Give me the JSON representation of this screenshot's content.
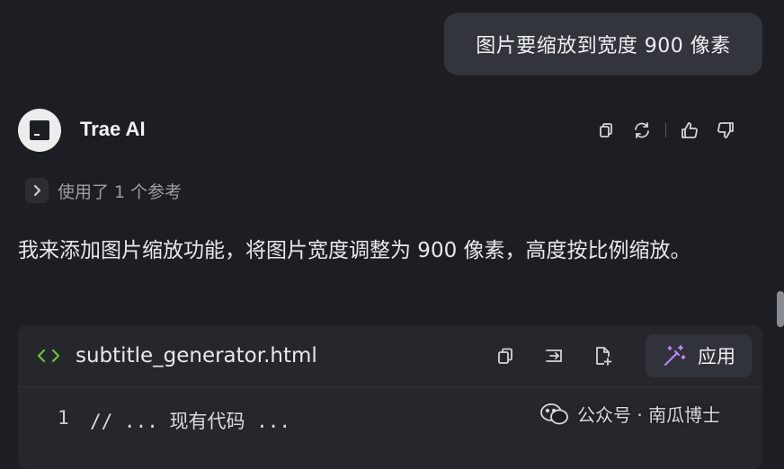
{
  "user_message": {
    "text": "图片要缩放到宽度 900 像素"
  },
  "assistant": {
    "name": "Trae AI",
    "avatar_icon": "trae-logo-icon",
    "actions": [
      {
        "name": "copy-icon"
      },
      {
        "name": "regenerate-icon"
      },
      {
        "name": "thumbs-up-icon"
      },
      {
        "name": "thumbs-down-icon"
      }
    ],
    "references_label": "使用了 1 个参考",
    "message_text": "我来添加图片缩放功能，将图片宽度调整为 900 像素，高度按比例缩放。"
  },
  "code_block": {
    "filename": "subtitle_generator.html",
    "apply_label": "应用",
    "lines": [
      {
        "number": "1",
        "code": "// ... 现有代码 ..."
      }
    ]
  },
  "watermark": {
    "text": "公众号 · 南瓜博士"
  },
  "colors": {
    "background": "#1d1e23",
    "bubble": "#33353d",
    "code_card": "#25272d",
    "file_icon_accent": "#69c23a",
    "apply_icon_accent": "#c084fc"
  }
}
